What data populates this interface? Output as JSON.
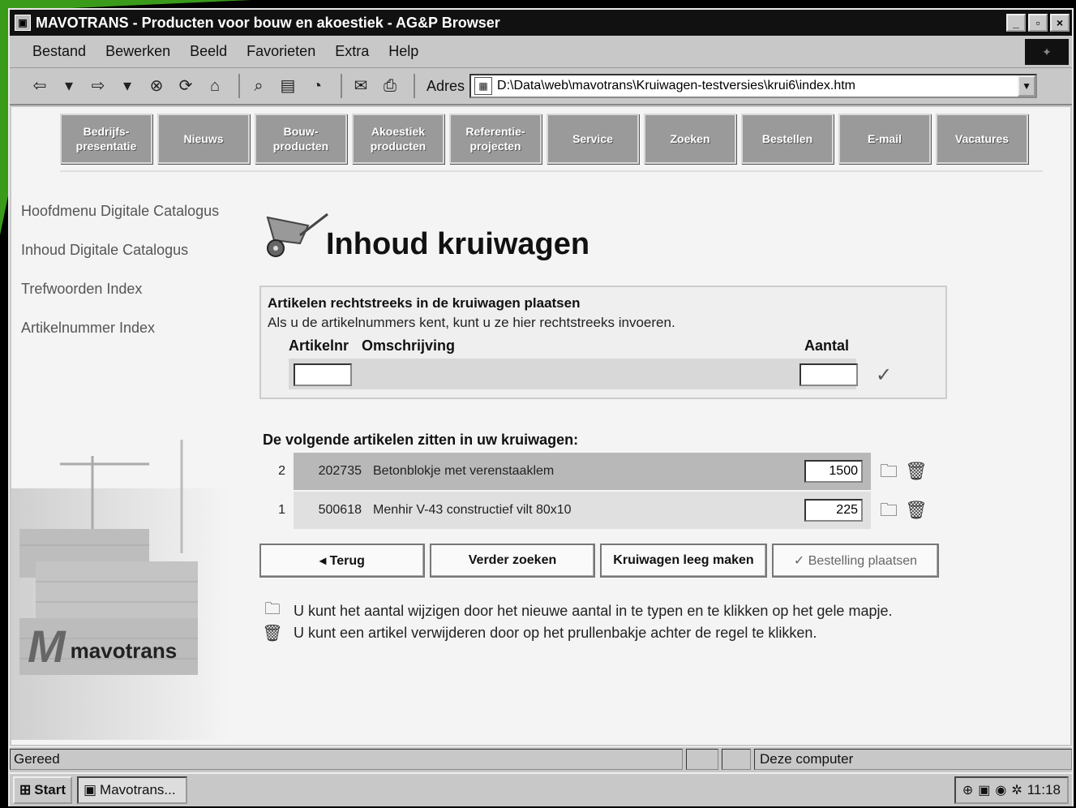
{
  "window": {
    "title": "MAVOTRANS - Producten voor bouw en akoestiek - AG&P Browser",
    "app_icon": "browser-page-icon"
  },
  "menu": [
    "Bestand",
    "Bewerken",
    "Beeld",
    "Favorieten",
    "Extra",
    "Help"
  ],
  "toolbar": {
    "address_label": "Adres",
    "address_value": "D:\\Data\\web\\mavotrans\\Kruiwagen-testversies\\krui6\\index.htm"
  },
  "nav": [
    "Bedrijfs-\npresentatie",
    "Nieuws",
    "Bouw-\nproducten",
    "Akoestiek\nproducten",
    "Referentie-\nprojecten",
    "Service",
    "Zoeken",
    "Bestellen",
    "E-mail",
    "Vacatures"
  ],
  "sidebar": [
    "Hoofdmenu Digitale Catalogus",
    "Inhoud Digitale Catalogus",
    "Trefwoorden Index",
    "Artikelnummer Index"
  ],
  "logo": {
    "mark": "M",
    "word": "mavotrans"
  },
  "page": {
    "title": "Inhoud kruiwagen"
  },
  "direct": {
    "title": "Artikelen rechtstreeks in de kruiwagen plaatsen",
    "desc": "Als u de artikelnummers kent, kunt u ze hier rechtstreeks invoeren.",
    "col_art": "Artikelnr",
    "col_desc": "Omschrijving",
    "col_qty": "Aantal",
    "art_value": "",
    "qty_value": ""
  },
  "cart": {
    "title": "De volgende artikelen zitten in uw kruiwagen:",
    "rows": [
      {
        "num": "2",
        "art": "202735",
        "desc": "Betonblokje met verenstaaklem",
        "qty": "1500",
        "bg": "#b8b8b8"
      },
      {
        "num": "1",
        "art": "500618",
        "desc": "Menhir V-43 constructief vilt 80x10",
        "qty": "225",
        "bg": "#e0e0e0"
      }
    ]
  },
  "buttons": {
    "back": "◂ Terug",
    "search": "Verder zoeken",
    "empty": "Kruiwagen leeg maken",
    "order": "✓ Bestelling plaatsen"
  },
  "notes": {
    "folder": "U kunt het aantal wijzigen door het nieuwe aantal in te typen en te klikken op het gele mapje.",
    "trash": "U kunt een artikel verwijderen door op het prullenbakje achter de regel te klikken."
  },
  "status": {
    "left": "Gereed",
    "zone": "Deze computer"
  },
  "taskbar": {
    "start": "Start",
    "item": "Mavotrans...",
    "clock": "11:18"
  },
  "colors": {
    "accent_green": "#3a9a1a",
    "nav_button": "#9a9a9a",
    "titlebar": "#111111"
  }
}
